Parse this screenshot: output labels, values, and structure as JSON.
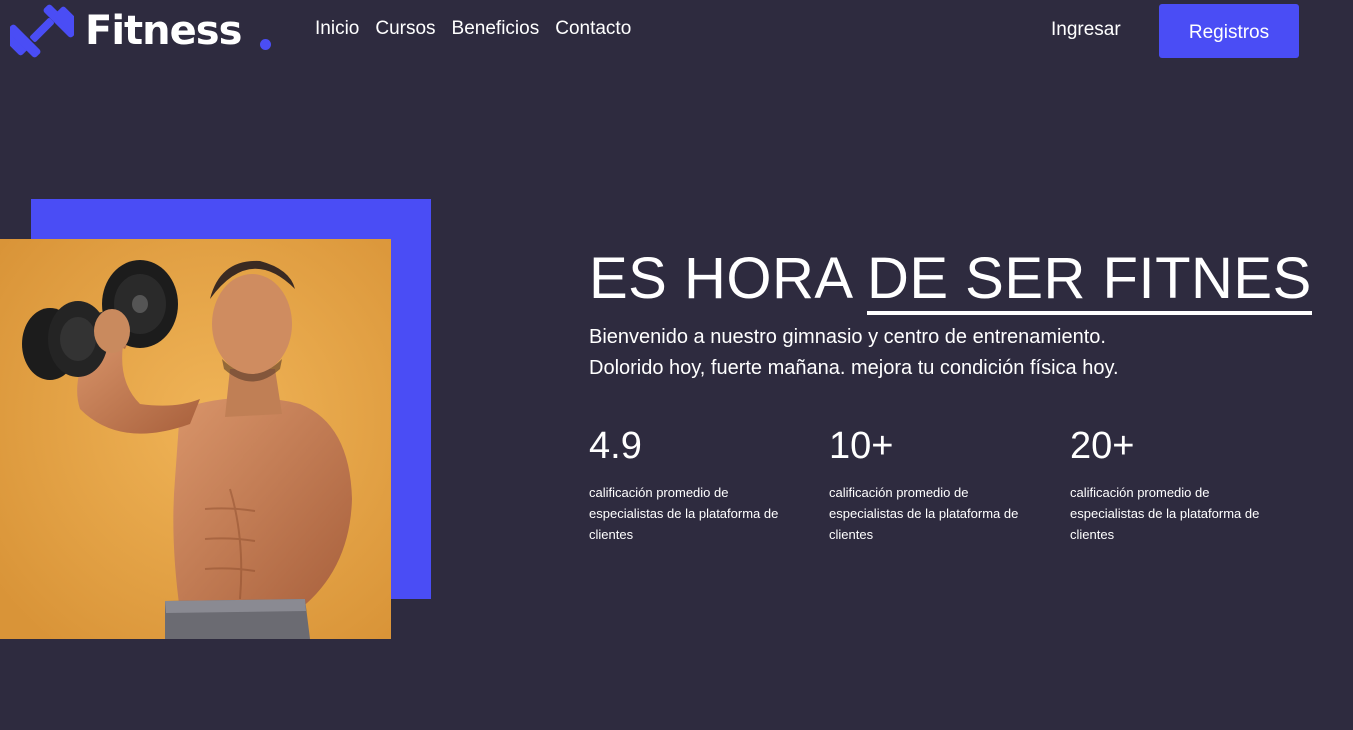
{
  "brand": {
    "name": "Fitness",
    "accent": "#4a4df5",
    "background": "#2e2b3f",
    "logo_icon": "dumbbell-icon"
  },
  "nav": {
    "items": [
      "Inicio",
      "Cursos",
      "Beneficios",
      "Contacto"
    ]
  },
  "header": {
    "login_label": "Ingresar",
    "register_label": "Registros"
  },
  "hero": {
    "headline_plain": "ES HORA ",
    "headline_underlined": "DE SER FITNES",
    "subtitle_line1": "Bienvenido a nuestro gimnasio y centro de entrenamiento.",
    "subtitle_line2": "Dolorido hoy, fuerte mañana. mejora tu condición física hoy.",
    "image": "man-lifting-dumbbell-photo",
    "image_background": "#e3a44a"
  },
  "stats": [
    {
      "value": "4.9",
      "description": "calificación promedio de especialistas de la plataforma de clientes"
    },
    {
      "value": "10+",
      "description": "calificación promedio de especialistas de la plataforma de clientes"
    },
    {
      "value": "20+",
      "description": "calificación promedio de especialistas de la plataforma de clientes"
    }
  ]
}
